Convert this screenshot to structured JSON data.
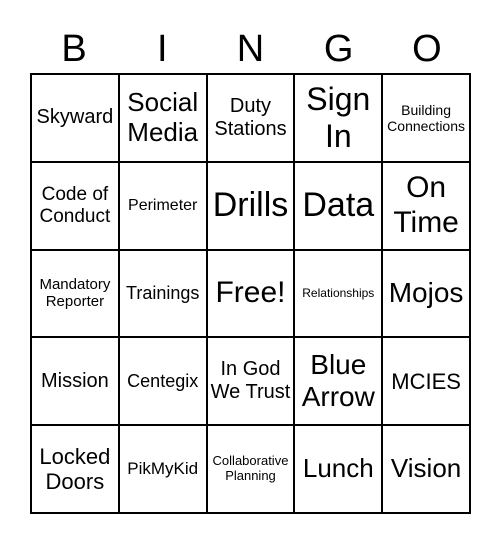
{
  "header": {
    "letters": [
      "B",
      "I",
      "N",
      "G",
      "O"
    ]
  },
  "cells": [
    "Skyward",
    "Social Media",
    "Duty Stations",
    "Sign In",
    "Building Connections",
    "Code of Conduct",
    "Perimeter",
    "Drills",
    "Data",
    "On Time",
    "Mandatory Reporter",
    "Trainings",
    "Free!",
    "Relationships",
    "Mojos",
    "Mission",
    "Centegix",
    "In God We Trust",
    "Blue Arrow",
    "MCIES",
    "Locked Doors",
    "PikMyKid",
    "Collaborative Planning",
    "Lunch",
    "Vision"
  ]
}
